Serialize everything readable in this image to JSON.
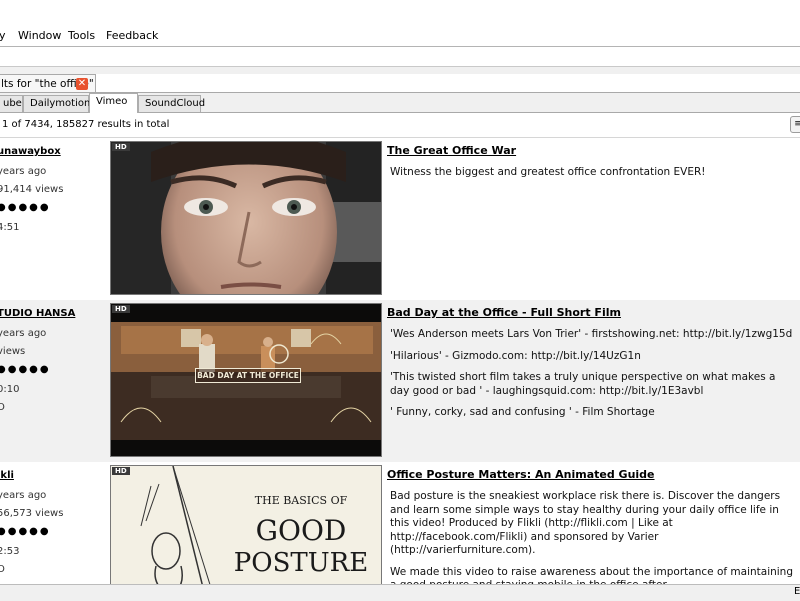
{
  "menu": {
    "items": [
      "y",
      "Window",
      "Tools",
      "Feedback"
    ]
  },
  "search_tab": {
    "label": "lts for \"the office\"",
    "close_glyph": "✕"
  },
  "source_tabs": [
    {
      "label": "ube",
      "active": false
    },
    {
      "label": "Dailymotion",
      "active": false
    },
    {
      "label": "Vimeo",
      "active": true
    },
    {
      "label": "SoundCloud",
      "active": false
    }
  ],
  "status": {
    "text": "1 of 7434, 185827 results in total",
    "button_glyph": "≡"
  },
  "results": [
    {
      "author": "unawaybox",
      "age": "years ago",
      "views": "91,414 views",
      "rating": "●●●●●",
      "duration": "4:51",
      "extra": "",
      "hd_badge": "HD",
      "title": "The Great Office War",
      "description": [
        "Witness the biggest and greatest office confrontation EVER!"
      ]
    },
    {
      "author": "TUDIO HANSA",
      "age": "years ago",
      "views": "views",
      "rating": "●●●●●",
      "duration": "0:10",
      "extra": "O",
      "hd_badge": "HD",
      "title": "Bad Day at the Office - Full Short Film",
      "description": [
        "'Wes Anderson meets Lars Von Trier' - firstshowing.net: http://bit.ly/1zwg15d",
        "'Hilarious' - Gizmodo.com: http://bit.ly/14UzG1n",
        "'This twisted short film takes a truly unique perspective on what makes a day good or bad ' - laughingsquid.com: http://bit.ly/1E3avbl",
        "' Funny, corky, sad and confusing ' - Film Shortage"
      ],
      "thumb_text": "BAD DAY AT THE OFFICE"
    },
    {
      "author": "ikli",
      "age": "years ago",
      "views": "56,573 views",
      "rating": "●●●●●",
      "duration": "2:53",
      "extra": "O",
      "hd_badge": "HD",
      "title": "Office Posture Matters: An Animated Guide",
      "description": [
        "Bad posture is the sneakiest workplace risk there is. Discover the dangers and learn some simple ways to stay healthy during your daily office life in this video! Produced by Flikli (http://flikli.com | Like at http://facebook.com/Flikli) and sponsored by Varier (http://varierfurniture.com).",
        "We made this video to raise awareness about the importance of maintaining a good posture and staying mobile in the office after"
      ],
      "thumb_text_1": "THE BASICS OF",
      "thumb_text_2": "GOOD",
      "thumb_text_3": "POSTURE"
    }
  ],
  "bottom": {
    "corner_glyph": "E"
  },
  "colors": {
    "close_accent": "#e8522e",
    "hd_badge_bg": "#3a3a3a",
    "row_alt": "#f1f1f1"
  }
}
